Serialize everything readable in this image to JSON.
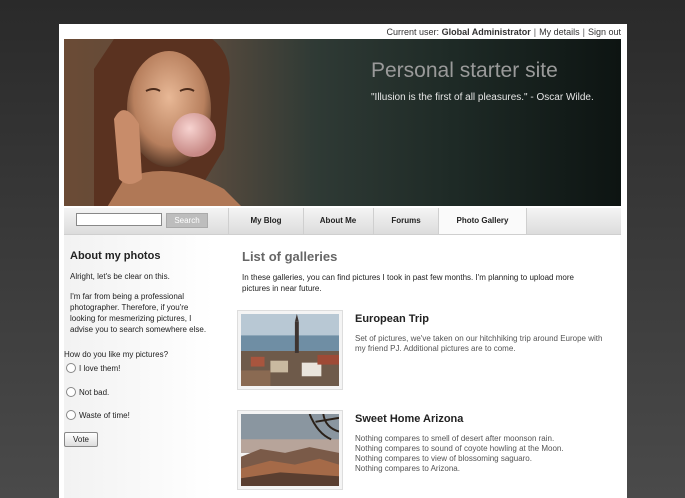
{
  "topbar": {
    "current_user_label": "Current user:",
    "user_name": "Global Administrator",
    "my_details": "My details",
    "sign_out": "Sign out"
  },
  "banner": {
    "title": "Personal starter site",
    "quote": "\"Illusion is the first of all pleasures.\" - Oscar Wilde."
  },
  "nav": {
    "search_value": "",
    "search_button": "Search",
    "tabs": [
      {
        "label": "My Blog"
      },
      {
        "label": "About Me"
      },
      {
        "label": "Forums"
      },
      {
        "label": "Photo Gallery"
      }
    ]
  },
  "sidebar": {
    "heading": "About my photos",
    "para1": "Alright, let's be clear on this.",
    "para2": "I'm far from being a professional photographer. Therefore, if you're looking for mesmerizing pictures, I advise you to search somewhere else.",
    "poll_question": "How do you like my pictures?",
    "options": [
      {
        "label": "I love them!"
      },
      {
        "label": "Not bad."
      },
      {
        "label": "Waste of time!"
      }
    ],
    "vote_button": "Vote"
  },
  "main": {
    "heading": "List of galleries",
    "intro": "In these galleries, you can find pictures I took in past few months. I'm planning to upload more pictures in near future.",
    "galleries": [
      {
        "title": "European Trip",
        "description": "Set of pictures, we've taken on our hitchhiking trip around Europe with my friend PJ. Additional pictures are to come."
      },
      {
        "title": "Sweet Home Arizona",
        "lines": [
          "Nothing compares to smell of desert after moonson rain.",
          "Nothing compares to sound of coyote howling at the Moon.",
          "Nothing compares to view of blossoming saguaro.",
          "Nothing compares to Arizona."
        ]
      }
    ]
  }
}
